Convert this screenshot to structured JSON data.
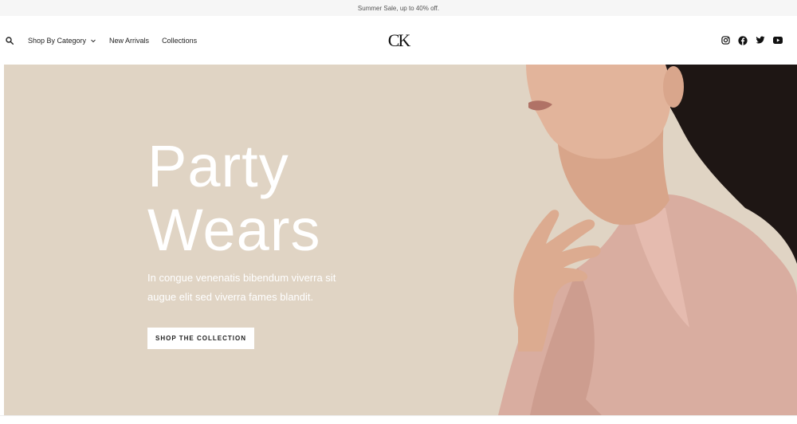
{
  "announcement": "Summer Sale, up to 40% off.",
  "nav": {
    "items": [
      "Shop By Category",
      "New Arrivals",
      "Collections"
    ]
  },
  "logo": "CK",
  "social": [
    "instagram-icon",
    "facebook-icon",
    "twitter-icon",
    "youtube-icon"
  ],
  "hero": {
    "title_line1": "Party",
    "title_line2": "Wears",
    "subtitle_line1": "In congue venenatis bibendum viverra sit",
    "subtitle_line2": "augue elit sed viverra fames blandit.",
    "cta": "SHOP THE COLLECTION"
  },
  "colors": {
    "hero_bg": "#e0d4c4",
    "announcement_bg": "#f6f6f6"
  }
}
